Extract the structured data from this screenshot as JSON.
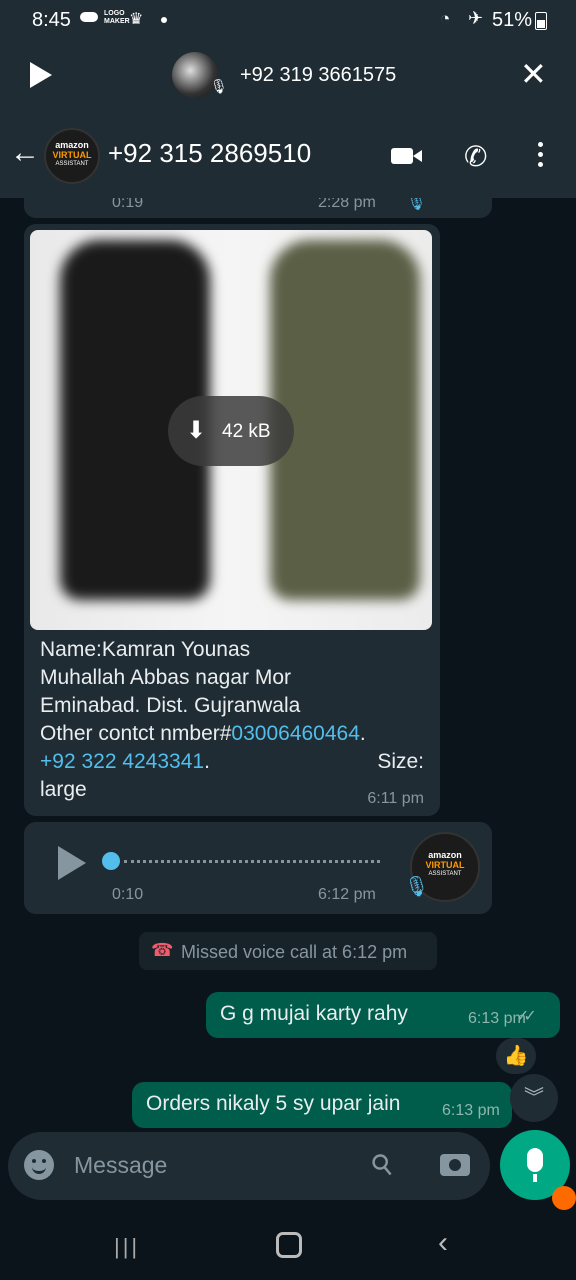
{
  "status_bar": {
    "time": "8:45",
    "logo_text": "LOGO MAKER",
    "battery": "51%"
  },
  "voice_player": {
    "number": "+92 319 3661575"
  },
  "app_bar": {
    "title": "+92 315 2869510",
    "avatar_l1": "amazon",
    "avatar_l2": "VIRTUAL",
    "avatar_l3": "ASSISTANT"
  },
  "messages": {
    "top_voice": {
      "duration": "0:19",
      "time": "2:28 pm"
    },
    "image_msg": {
      "download_size": "42 kB",
      "caption_1": "Name:Kamran Younas",
      "caption_2": "Muhallah Abbas nagar Mor",
      "caption_3": "Eminabad. Dist. Gujranwala",
      "caption_4a": "Other contct nmber#",
      "caption_4b": "03006460464",
      "caption_4c": ".",
      "caption_5a": "+92 322 4243341",
      "caption_5b": ".",
      "caption_5c": "Size:",
      "caption_6": "large",
      "time": "6:11 pm"
    },
    "voice_msg": {
      "duration": "0:10",
      "time": "6:12 pm"
    },
    "missed_call": "Missed voice call at 6:12 pm",
    "out1": {
      "text": "G g mujai karty rahy",
      "time": "6:13 pm",
      "reaction": "👍"
    },
    "out2": {
      "text": "Orders nikaly 5 sy upar jain",
      "time": "6:13 pm"
    }
  },
  "input": {
    "placeholder": "Message"
  },
  "colors": {
    "accent": "#00a884",
    "outgoing": "#005c4b",
    "incoming": "#202c33",
    "link": "#53bdeb"
  }
}
